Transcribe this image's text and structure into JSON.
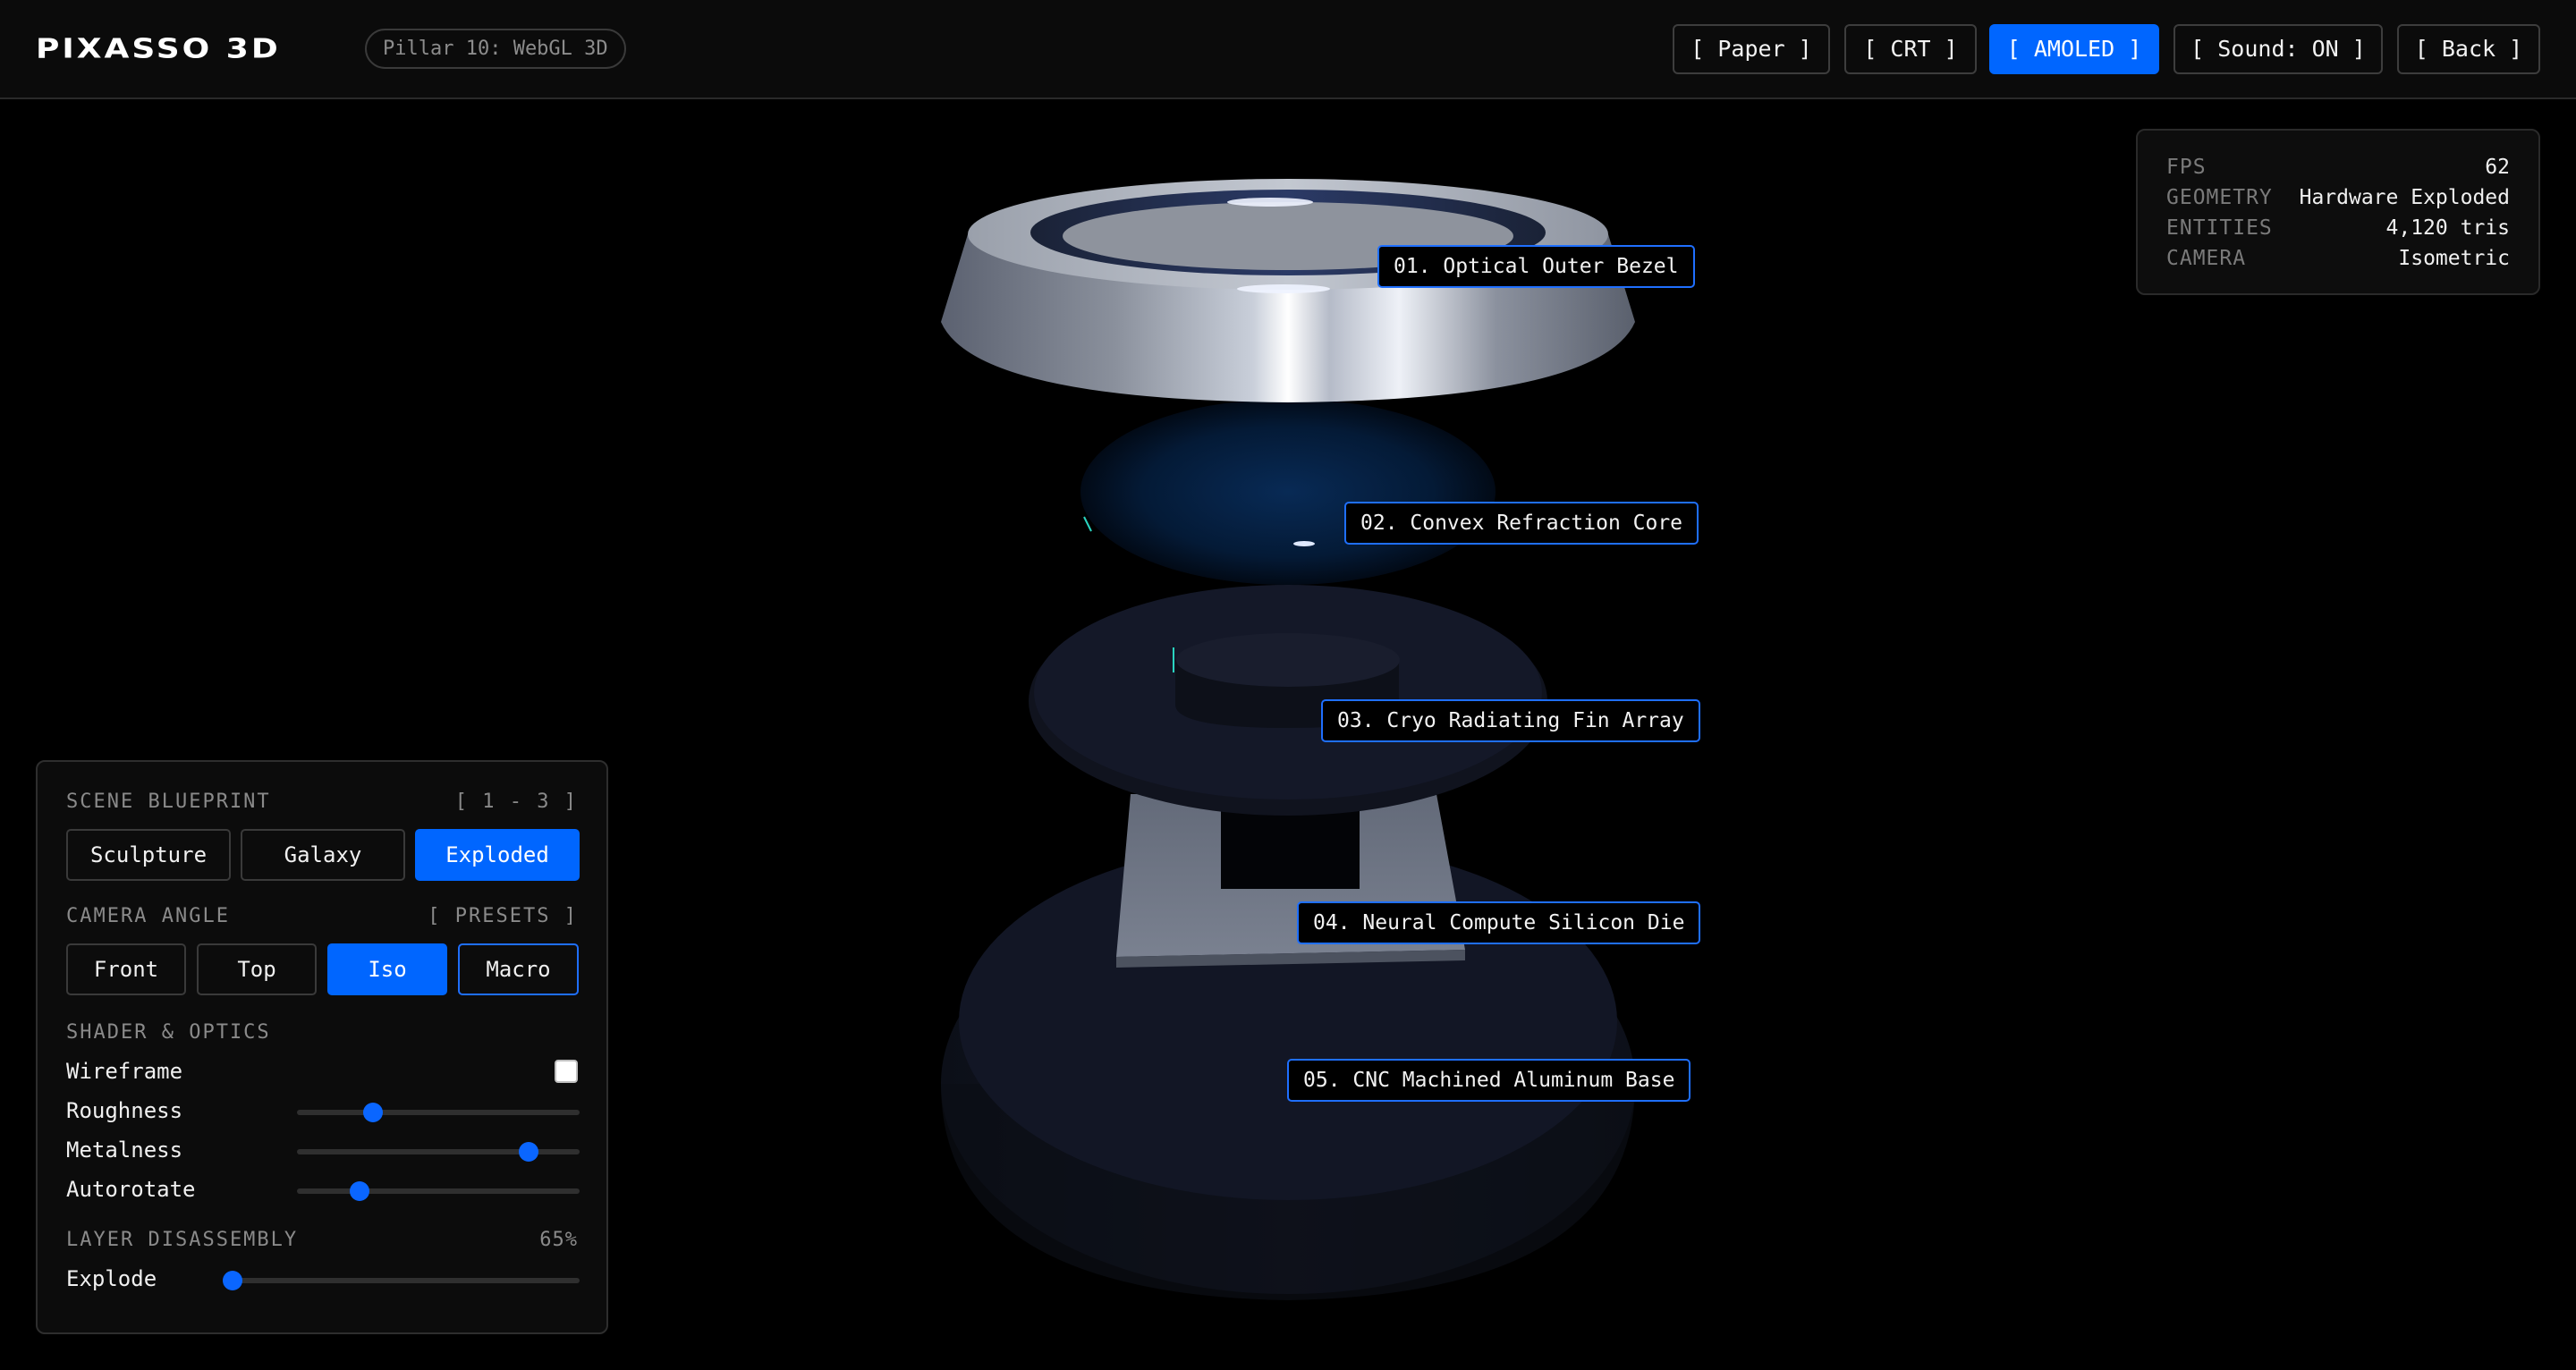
{
  "header": {
    "logo": "PIXASSO 3D",
    "pillar": "Pillar 10: WebGL 3D",
    "buttons": [
      {
        "label": "[ Paper ]",
        "active": false
      },
      {
        "label": "[ CRT ]",
        "active": false
      },
      {
        "label": "[ AMOLED ]",
        "active": true
      },
      {
        "label": "[ Sound: ON ]",
        "active": false
      },
      {
        "label": "[ Back ]",
        "active": false
      }
    ]
  },
  "stats": {
    "rows": [
      {
        "key": "FPS",
        "value": "62"
      },
      {
        "key": "GEOMETRY",
        "value": "Hardware Exploded"
      },
      {
        "key": "ENTITIES",
        "value": "4,120 tris"
      },
      {
        "key": "CAMERA",
        "value": "Isometric"
      }
    ]
  },
  "scene": {
    "labels": [
      "01. Optical Outer Bezel",
      "02. Convex Refraction Core",
      "03. Cryo Radiating Fin Array",
      "04. Neural Compute Silicon Die",
      "05. CNC Machined Aluminum Base"
    ]
  },
  "panel": {
    "blueprint": {
      "title": "SCENE BLUEPRINT",
      "hint": "[ 1 - 3 ]",
      "options": [
        {
          "label": "Sculpture",
          "active": false
        },
        {
          "label": "Galaxy",
          "active": false
        },
        {
          "label": "Exploded",
          "active": true
        }
      ]
    },
    "camera": {
      "title": "CAMERA ANGLE",
      "hint": "[ PRESETS ]",
      "options": [
        {
          "label": "Front",
          "active": false
        },
        {
          "label": "Top",
          "active": false
        },
        {
          "label": "Iso",
          "active": true
        },
        {
          "label": "Macro",
          "active": false,
          "hover": true
        }
      ]
    },
    "shader": {
      "title": "SHADER & OPTICS",
      "wireframe_label": "Wireframe",
      "wireframe_checked": false,
      "sliders": [
        {
          "label": "Roughness",
          "value": 0.27
        },
        {
          "label": "Metalness",
          "value": 0.82
        },
        {
          "label": "Autorotate",
          "value": 0.22
        }
      ]
    },
    "disassembly": {
      "title": "LAYER DISASSEMBLY",
      "percent": "65%",
      "explode_label": "Explode",
      "explode_value": 0.0
    }
  },
  "colors": {
    "accent": "#0066ff",
    "background": "#000000",
    "panel": "#0c0c0c"
  }
}
